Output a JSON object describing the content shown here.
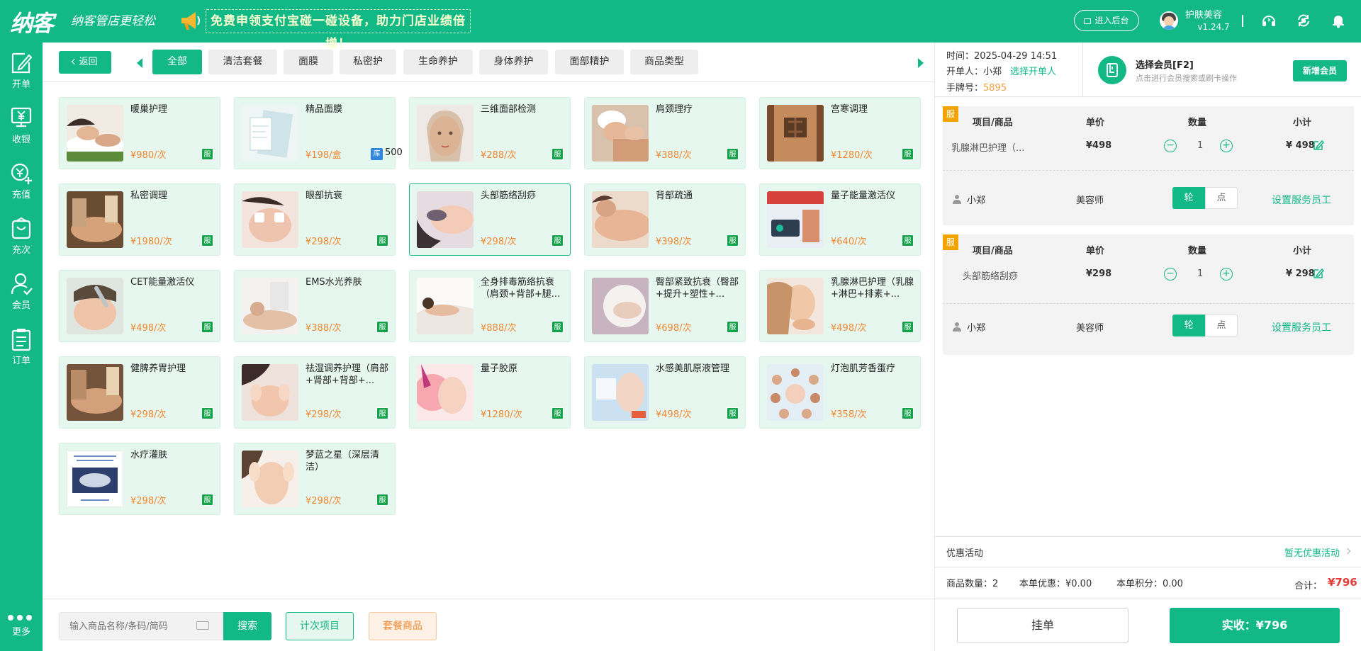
{
  "header": {
    "logo": "纳客",
    "slogan": "纳客管店更轻松",
    "banner": "免费申领支付宝碰一碰设备，助力门店业绩倍增！",
    "backend_button": "进入后台",
    "store_name": "护肤美容",
    "version": "v1.24.7",
    "icons": [
      "headset-icon",
      "refresh-icon",
      "bell-icon"
    ]
  },
  "sidebar": {
    "items": [
      {
        "label": "开单",
        "icon": "edit-doc-icon",
        "active": true
      },
      {
        "label": "收银",
        "icon": "register-icon"
      },
      {
        "label": "充值",
        "icon": "recharge-icon"
      },
      {
        "label": "充次",
        "icon": "count-card-icon"
      },
      {
        "label": "会员",
        "icon": "member-icon"
      },
      {
        "label": "订单",
        "icon": "order-list-icon"
      }
    ],
    "more_label": "更多"
  },
  "categories": {
    "back_label": "返回",
    "tabs": [
      {
        "label": "全部",
        "active": true
      },
      {
        "label": "清洁套餐"
      },
      {
        "label": "面膜"
      },
      {
        "label": "私密护"
      },
      {
        "label": "生命养护"
      },
      {
        "label": "身体养护"
      },
      {
        "label": "面部精护"
      },
      {
        "label": "商品类型"
      }
    ]
  },
  "products": [
    {
      "name": "暖巢护理",
      "price": "¥980/次",
      "tag": "服",
      "img": "spa-stones"
    },
    {
      "name": "精品面膜",
      "price": "¥198/盒",
      "stock_tag": "库",
      "stock": "500",
      "img": "mask-pack"
    },
    {
      "name": "三维面部检测",
      "price": "¥288/次",
      "tag": "服",
      "img": "face-portrait"
    },
    {
      "name": "肩颈理疗",
      "price": "¥388/次",
      "tag": "服",
      "img": "towel-massage"
    },
    {
      "name": "宫寒调理",
      "price": "¥1280/次",
      "tag": "服",
      "img": "moxa-back"
    },
    {
      "name": "私密调理",
      "price": "¥1980/次",
      "tag": "服",
      "img": "back-massage-brown"
    },
    {
      "name": "眼部抗衰",
      "price": "¥298/次",
      "tag": "服",
      "img": "eye-treatment"
    },
    {
      "name": "头部筋络刮痧",
      "price": "¥298/次",
      "tag": "服",
      "img": "head-gua-sha",
      "selected": true
    },
    {
      "name": "背部疏通",
      "price": "¥398/次",
      "tag": "服",
      "img": "shoulder-massage"
    },
    {
      "name": "量子能量激活仪",
      "price": "¥640/次",
      "tag": "服",
      "img": "device-ad"
    },
    {
      "name": "CET能量激活仪",
      "price": "¥498/次",
      "tag": "服",
      "img": "facial-device"
    },
    {
      "name": "EMS水光养肤",
      "price": "¥388/次",
      "tag": "服",
      "img": "lying-facial"
    },
    {
      "name": "全身排毒筋络抗衰（肩颈+背部+腿...",
      "price": "¥888/次",
      "tag": "服",
      "img": "white-towel"
    },
    {
      "name": "臀部紧致抗衰（臀部+提升+塑性+...",
      "price": "¥698/次",
      "tag": "服",
      "img": "hip-circle"
    },
    {
      "name": "乳腺淋巴护理（乳腺+淋巴+排素+...",
      "price": "¥498/次",
      "tag": "服",
      "img": "neck-touch"
    },
    {
      "name": "健脾养胃护理",
      "price": "¥298/次",
      "tag": "服",
      "img": "back-massage-brown2"
    },
    {
      "name": "祛湿调养护理（肩部+肾部+背部+...",
      "price": "¥298/次",
      "tag": "服",
      "img": "facial-hands"
    },
    {
      "name": "量子胶原",
      "price": "¥1280/次",
      "tag": "服",
      "img": "led-light"
    },
    {
      "name": "水感美肌原液管理",
      "price": "¥498/次",
      "tag": "服",
      "img": "serum-poster"
    },
    {
      "name": "灯泡肌芳香蛋疗",
      "price": "¥358/次",
      "tag": "服",
      "img": "skin-circles"
    },
    {
      "name": "水疗灌肤",
      "price": "¥298/次",
      "tag": "服",
      "img": "hydro-poster"
    },
    {
      "name": "梦蓝之星（深层清洁）",
      "price": "¥298/次",
      "tag": "服",
      "img": "face-cleansing"
    }
  ],
  "search": {
    "placeholder": "输入商品名称/条码/简码",
    "search_button": "搜索",
    "count_button": "计次项目",
    "package_button": "套餐商品"
  },
  "order": {
    "time_label": "时间：",
    "time": "2025-04-29 14:51",
    "operator_label": "开单人：",
    "operator": "小郑",
    "select_operator": "选择开单人",
    "plate_label": "手牌号：",
    "plate": "5895",
    "member_title": "选择会员[F2]",
    "member_hint": "点击进行会员搜索或刷卡操作",
    "new_member_button": "新增会员",
    "columns": {
      "item": "项目/商品",
      "price": "单价",
      "qty": "数量",
      "subtotal": "小计"
    },
    "lines": [
      {
        "tag": "服",
        "name": "乳腺淋巴护理（...",
        "price": "¥498",
        "qty": "1",
        "subtotal": "¥ 498",
        "staff": "小郑",
        "role": "美容师",
        "toggle_on": "轮",
        "toggle_off": "点",
        "set_staff": "设置服务员工"
      },
      {
        "tag": "服",
        "name": "头部筋络刮痧",
        "price": "¥298",
        "qty": "1",
        "subtotal": "¥ 298",
        "staff": "小郑",
        "role": "美容师",
        "toggle_on": "轮",
        "toggle_off": "点",
        "set_staff": "设置服务员工"
      }
    ],
    "promo_label": "优惠活动",
    "promo_value": "暂无优惠活动",
    "summary": {
      "count": "商品数量：2",
      "discount": "本单优惠：¥0.00",
      "points": "本单积分：0.00",
      "total_label": "合计：",
      "total": "¥796"
    },
    "hold_button": "挂单",
    "pay_button": "实收：¥796"
  },
  "colors": {
    "brand": "#12b886",
    "price": "#f0872e",
    "total": "#e53935",
    "service_tag": "#12a34a",
    "order_tag": "#f3a300"
  }
}
